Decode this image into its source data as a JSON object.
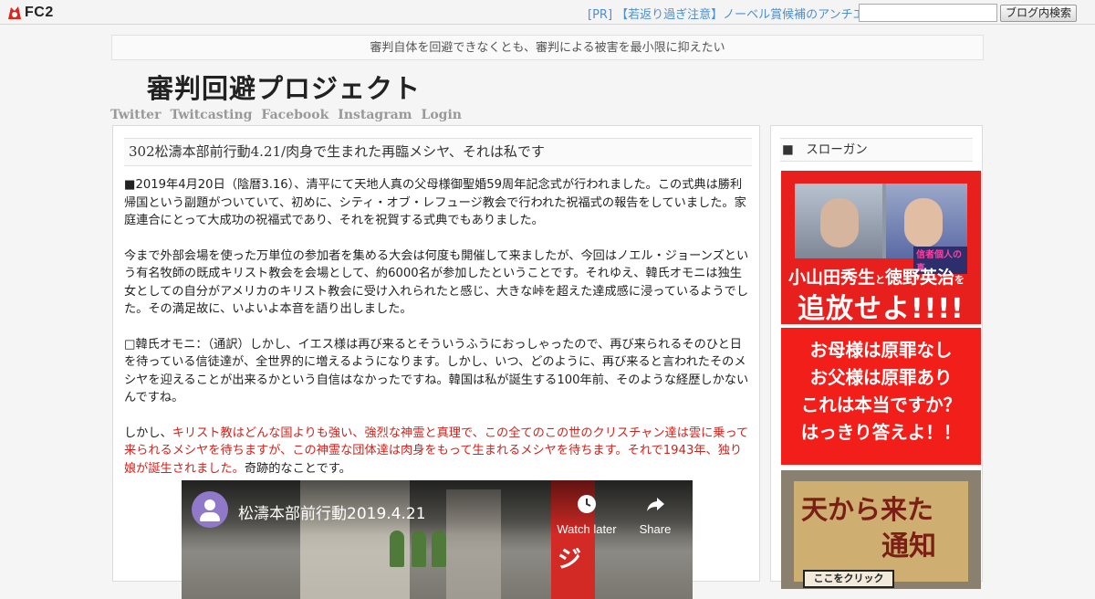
{
  "fc2bar": {
    "logo_text": "FC2",
    "pr_link": "[PR] 【若返り過ぎ注意】ノーベル賞候補のアンチエイ",
    "search_value": "",
    "search_button": "ブログ内検索"
  },
  "blog": {
    "description": "審判自体を回避できなくとも、審判による被害を最小限に抑えたい",
    "title": "審判回避プロジェクト",
    "nav": [
      "Twitter",
      "Twitcasting",
      "Facebook",
      "Instagram",
      "Login"
    ]
  },
  "entry": {
    "title": "302松濤本部前行動4.21/肉身で生まれた再臨メシヤ、それは私です",
    "paragraphs": {
      "p1": "■2019年4月20日（陰暦3.16）、清平にて天地人真の父母様御聖婚59周年記念式が行われました。この式典は勝利帰国という副題がついていて、初めに、シティ・オブ・レフュージ教会で行われた祝福式の報告をしていました。家庭連合にとって大成功の祝福式であり、それを祝賀する式典でもありました。",
      "p2": "今まで外部会場を使った万単位の参加者を集める大会は何度も開催して来ましたが、今回はノエル・ジョーンズという有名牧師の既成キリスト教会を会場として、約6000名が参加したということです。それゆえ、韓氏オモニは独生女としての自分がアメリカのキリスト教会に受け入れられたと感じ、大きな峠を超えた達成感に浸っているようでした。その満足故に、いよいよ本音を語り出しました。",
      "p3": "□韓氏オモニ：（通訳）しかし、イエス様は再び来るとそういうふうにおっしゃったので、再び来られるそのひと日を待っている信徒達が、全世界的に増えるようになります。しかし、いつ、どのように、再び来ると言われたそのメシヤを迎えることが出来るかという自信はなかったですね。韓国は私が誕生する100年前、そのような経歴しかないんですね。",
      "p4_lead": "しかし、",
      "p4_red": "キリスト教はどんな国よりも強い、強烈な神霊と真理で、この全てのこの世のクリスチャン達は雲に乗って来られるメシヤを待ちますが、この神霊な団体達は肉身をもって生まれるメシヤを待ちます。それで1943年、独り娘が誕生されました。",
      "p4_tail": "奇跡的なことです。"
    },
    "video": {
      "title": "松濤本部前行動2019.4.21",
      "watch_later": "Watch later",
      "share": "Share",
      "flag_text": "ジ"
    }
  },
  "sidebar": {
    "heading": "■　スローガン",
    "banner1": {
      "caption": "信者個人の真",
      "line1_a": "小山田秀生",
      "line1_to": "と",
      "line1_b": "徳野英治",
      "line1_wo": "を",
      "line2": "追放せよ!!!!"
    },
    "banner2": [
      "お母様は原罪なし",
      "お父様は原罪あり",
      "これは本当ですか？",
      "はっきり答えよ！！"
    ],
    "banner3": {
      "line1": "天から来た",
      "line2": "通知",
      "strip": "ここをクリック"
    }
  },
  "colors": {
    "accent_red": "#d0231d",
    "link_blue": "#4d8fd1",
    "banner_red": "#f21e1a"
  }
}
